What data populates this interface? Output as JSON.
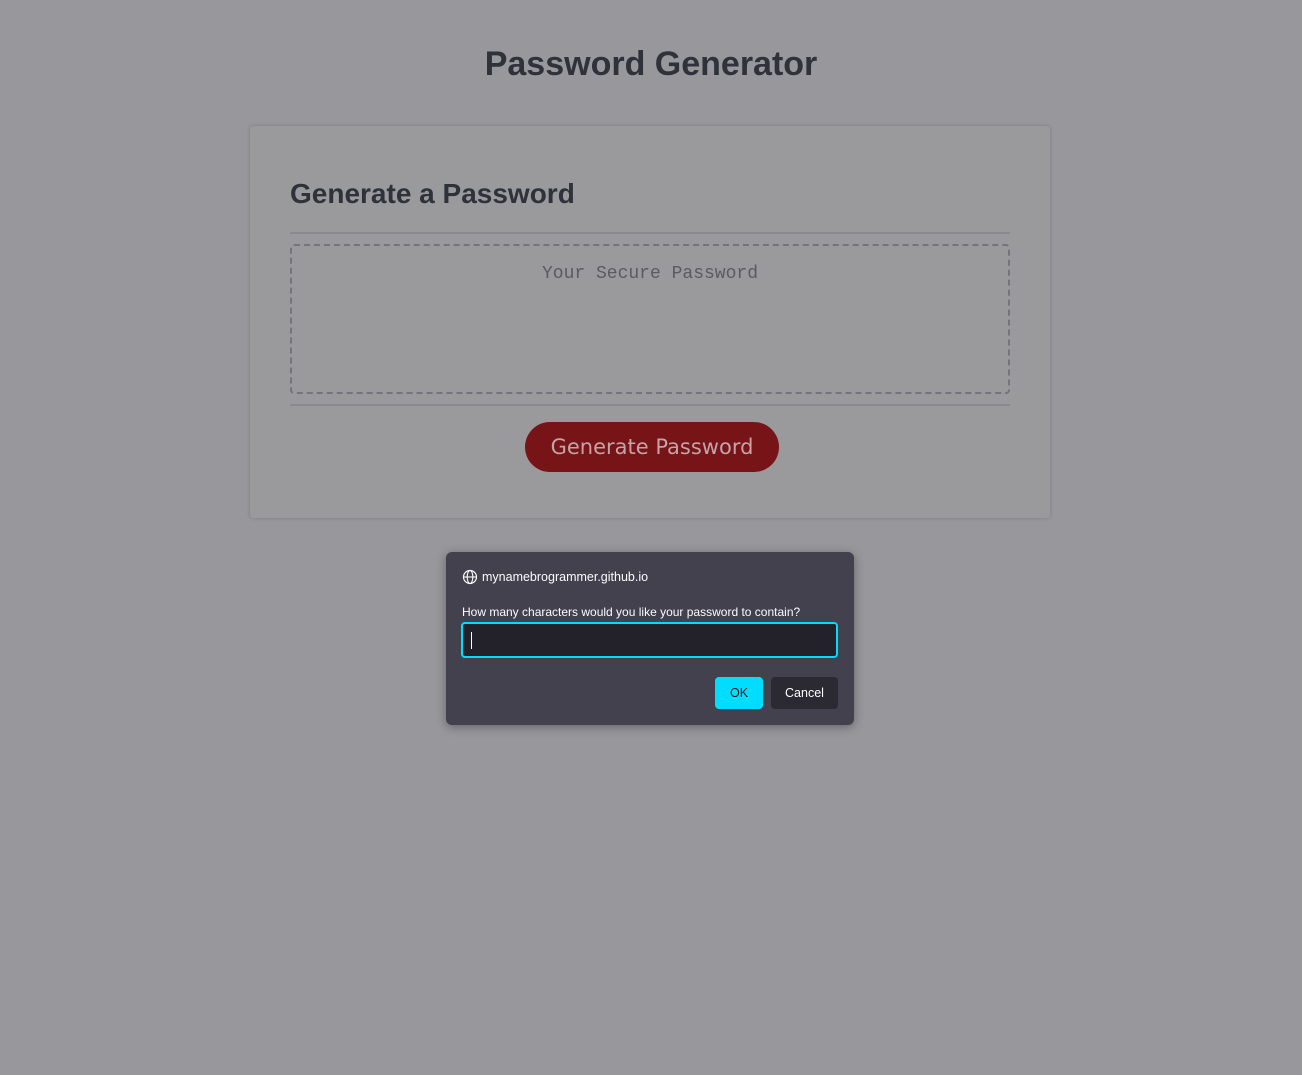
{
  "page": {
    "title": "Password Generator"
  },
  "card": {
    "header": "Generate a Password",
    "password_placeholder": "Your Secure Password",
    "password_value": "",
    "generate_button_label": "Generate Password"
  },
  "dialog": {
    "origin": "mynamebrogrammer.github.io",
    "origin_icon": "globe-icon",
    "message": "How many characters would you like your password to contain?",
    "input_value": "",
    "ok_label": "OK",
    "cancel_label": "Cancel"
  },
  "colors": {
    "overlay_background": "#98979b",
    "button_primary": "#761418",
    "dialog_background": "#42414d",
    "dialog_accent": "#00ddff"
  }
}
